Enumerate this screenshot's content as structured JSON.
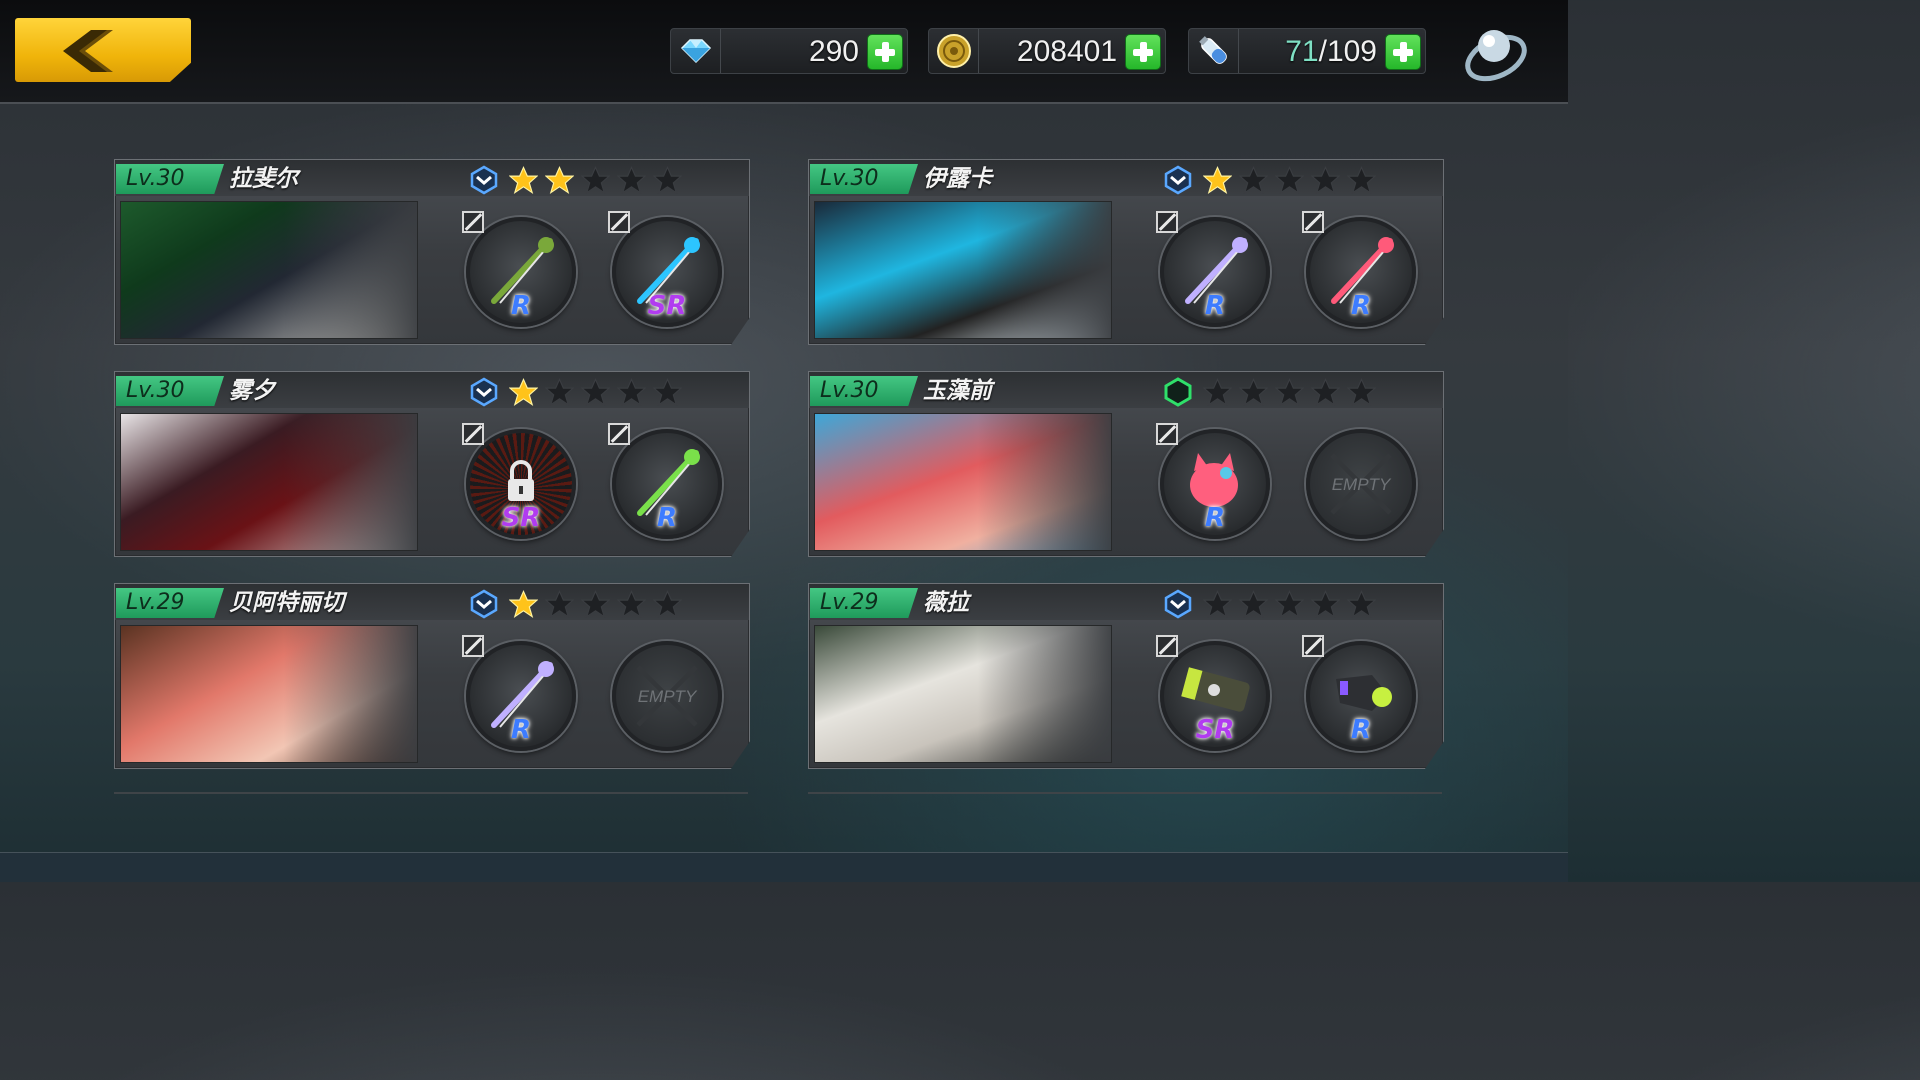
{
  "top_bar": {
    "back_icon": "chevron-left-icon",
    "resources": [
      {
        "icon": "crystal-icon",
        "value": "290"
      },
      {
        "icon": "gold-coin-icon",
        "value": "208401"
      },
      {
        "icon": "stamina-potion-icon",
        "current": "71",
        "separator": "/",
        "max": "109"
      }
    ],
    "menu_icon": "orb-menu-icon"
  },
  "cards": [
    {
      "level": "Lv.30",
      "name": "拉斐尔",
      "rank": "blue",
      "stars": 2,
      "slots": [
        {
          "rarity": "R",
          "item": "wand-icon"
        },
        {
          "rarity": "SR",
          "item": "chakram-icon"
        }
      ]
    },
    {
      "level": "Lv.30",
      "name": "伊露卡",
      "rank": "blue",
      "stars": 1,
      "slots": [
        {
          "rarity": "R",
          "item": "rifle-icon"
        },
        {
          "rarity": "R",
          "item": "sword-icon"
        }
      ]
    },
    {
      "level": "Lv.30",
      "name": "雾夕",
      "rank": "blue",
      "stars": 1,
      "slots": [
        {
          "rarity": "SR",
          "item": "lock-icon",
          "locked": true
        },
        {
          "rarity": "R",
          "item": "staff-icon"
        }
      ]
    },
    {
      "level": "Lv.30",
      "name": "玉藻前",
      "rank": "green",
      "stars": 0,
      "slots": [
        {
          "rarity": "R",
          "item": "charm-icon"
        },
        {
          "empty": true,
          "label": "EMPTY"
        }
      ]
    },
    {
      "level": "Lv.29",
      "name": "贝阿特丽切",
      "rank": "blue",
      "stars": 1,
      "slots": [
        {
          "rarity": "R",
          "item": "rapier-icon"
        },
        {
          "empty": true,
          "label": "EMPTY"
        }
      ]
    },
    {
      "level": "Lv.29",
      "name": "薇拉",
      "rank": "blue",
      "stars": 0,
      "slots": [
        {
          "rarity": "SR",
          "item": "death-cannon-icon"
        },
        {
          "rarity": "R",
          "item": "blaster-icon"
        }
      ]
    }
  ],
  "colors": {
    "level_tag": "#2fb36e",
    "rarity_r": "#3d7cff",
    "rarity_sr": "#b13cf0",
    "star_on": "#ffc31a",
    "star_off": "#1e2023",
    "accent_back": "#f0b40a"
  }
}
